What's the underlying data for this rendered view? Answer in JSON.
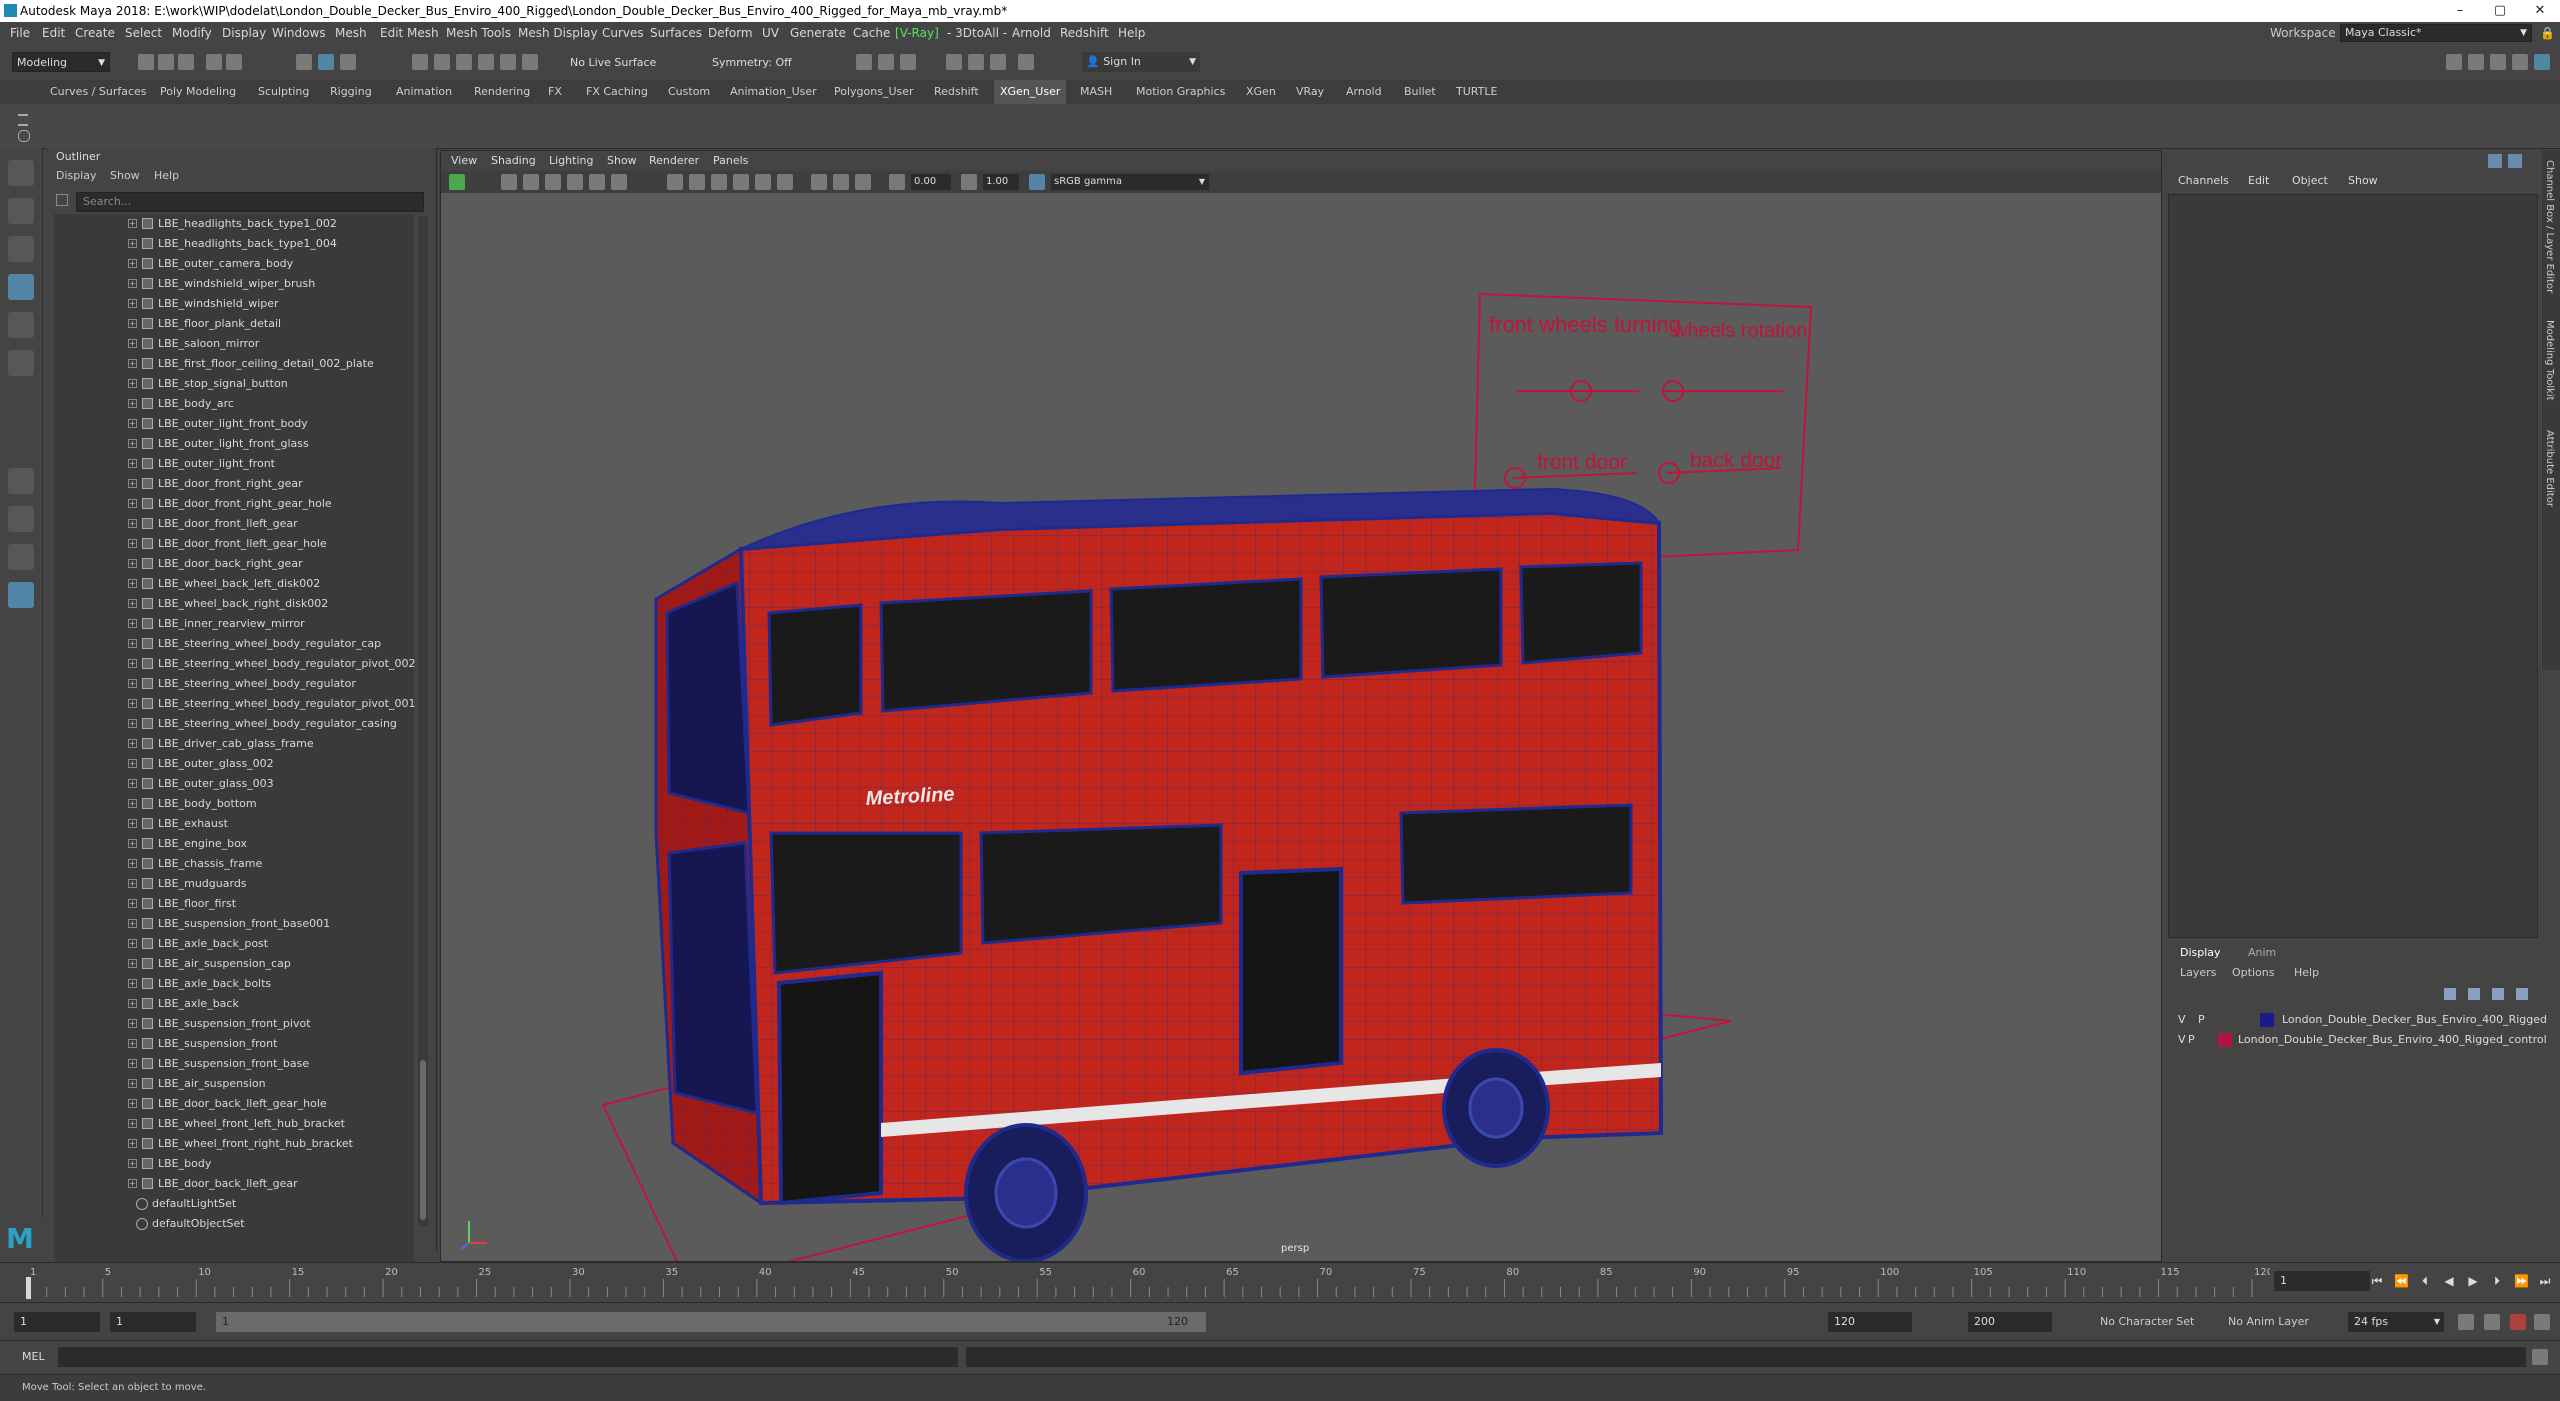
{
  "window": {
    "title": "Autodesk Maya 2018: E:\\work\\WIP\\dodelat\\London_Double_Decker_Bus_Enviro_400_Rigged\\London_Double_Decker_Bus_Enviro_400_Rigged_for_Maya_mb_vray.mb*",
    "minimize": "–",
    "maximize": "▢",
    "close": "✕"
  },
  "menubar": {
    "items": [
      "File",
      "Edit",
      "Create",
      "Select",
      "Modify",
      "Display",
      "Windows",
      "Mesh",
      "Edit Mesh",
      "Mesh Tools",
      "Mesh Display",
      "Curves",
      "Surfaces",
      "Deform",
      "UV",
      "Generate",
      "Cache",
      "V-Ray",
      "- 3DtoAll -",
      "Arnold",
      "Redshift",
      "Help"
    ],
    "workspace_label": "Workspace :",
    "workspace_value": "Maya Classic*"
  },
  "statusline": {
    "mode": "Modeling",
    "live_surface": "No Live Surface",
    "symmetry": "Symmetry: Off",
    "sign_in": "Sign In"
  },
  "shelf": {
    "tabs": [
      "Curves / Surfaces",
      "Poly Modeling",
      "Sculpting",
      "Rigging",
      "Animation",
      "Rendering",
      "FX",
      "FX Caching",
      "Custom",
      "Animation_User",
      "Polygons_User",
      "Redshift",
      "XGen_User",
      "MASH",
      "Motion Graphics",
      "XGen",
      "VRay",
      "Arnold",
      "Bullet",
      "TURTLE"
    ],
    "active": "XGen_User"
  },
  "outliner": {
    "title": "Outliner",
    "menu": [
      "Display",
      "Show",
      "Help"
    ],
    "search_placeholder": "Search...",
    "items": [
      "LBE_headlights_back_type1_002",
      "LBE_headlights_back_type1_004",
      "LBE_outer_camera_body",
      "LBE_windshield_wiper_brush",
      "LBE_windshield_wiper",
      "LBE_floor_plank_detail",
      "LBE_saloon_mirror",
      "LBE_first_floor_ceiling_detail_002_plate",
      "LBE_stop_signal_button",
      "LBE_body_arc",
      "LBE_outer_light_front_body",
      "LBE_outer_light_front_glass",
      "LBE_outer_light_front",
      "LBE_door_front_right_gear",
      "LBE_door_front_right_gear_hole",
      "LBE_door_front_lleft_gear",
      "LBE_door_front_lleft_gear_hole",
      "LBE_door_back_right_gear",
      "LBE_wheel_back_left_disk002",
      "LBE_wheel_back_right_disk002",
      "LBE_inner_rearview_mirror",
      "LBE_steering_wheel_body_regulator_cap",
      "LBE_steering_wheel_body_regulator_pivot_002",
      "LBE_steering_wheel_body_regulator",
      "LBE_steering_wheel_body_regulator_pivot_001",
      "LBE_steering_wheel_body_regulator_casing",
      "LBE_driver_cab_glass_frame",
      "LBE_outer_glass_002",
      "LBE_outer_glass_003",
      "LBE_body_bottom",
      "LBE_exhaust",
      "LBE_engine_box",
      "LBE_chassis_frame",
      "LBE_mudguards",
      "LBE_floor_first",
      "LBE_suspension_front_base001",
      "LBE_axle_back_post",
      "LBE_air_suspension_cap",
      "LBE_axle_back_bolts",
      "LBE_axle_back",
      "LBE_suspension_front_pivot",
      "LBE_suspension_front",
      "LBE_suspension_front_base",
      "LBE_air_suspension",
      "LBE_door_back_lleft_gear_hole",
      "LBE_wheel_front_left_hub_bracket",
      "LBE_wheel_front_right_hub_bracket",
      "LBE_body",
      "LBE_door_back_lleft_gear"
    ],
    "sets": [
      "defaultLightSet",
      "defaultObjectSet"
    ]
  },
  "viewport": {
    "menu": [
      "View",
      "Shading",
      "Lighting",
      "Show",
      "Renderer",
      "Panels"
    ],
    "field_a": "0.00",
    "field_b": "1.00",
    "colorspace": "sRGB gamma",
    "camera": "persp",
    "rig_labels": {
      "front_wheels": "front wheels turning",
      "wheels_rotation": "wheels rotation",
      "front_door": "front door",
      "back_door": "back door"
    },
    "bus_logo": "Metroline"
  },
  "channelbox": {
    "menu": [
      "Channels",
      "Edit",
      "Object",
      "Show"
    ],
    "side_tabs": [
      "Channel Box / Layer Editor",
      "Modeling Toolkit",
      "Attribute Editor"
    ]
  },
  "layers": {
    "tabs": [
      "Display",
      "Anim"
    ],
    "menu": [
      "Layers",
      "Options",
      "Help"
    ],
    "rows": [
      {
        "v": "V",
        "p": "P",
        "name": "London_Double_Decker_Bus_Enviro_400_Rigged",
        "color": "#1a1a8c"
      },
      {
        "v": "V",
        "p": "P",
        "name": "London_Double_Decker_Bus_Enviro_400_Rigged_control",
        "color": "#b0153e"
      }
    ]
  },
  "timeslider": {
    "ticks": [
      "1",
      "5",
      "10",
      "15",
      "20",
      "25",
      "30",
      "35",
      "40",
      "45",
      "50",
      "55",
      "60",
      "65",
      "70",
      "75",
      "80",
      "85",
      "90",
      "95",
      "100",
      "105",
      "110",
      "115",
      "120"
    ],
    "current_frame": "1"
  },
  "range": {
    "start": "1",
    "inner_start": "1",
    "slider_start": "1",
    "slider_end": "120",
    "end": "120",
    "outer_end": "200",
    "character_set": "No Character Set",
    "anim_layer": "No Anim Layer",
    "fps": "24 fps"
  },
  "cmd": {
    "label": "MEL",
    "help": "Move Tool: Select an object to move."
  },
  "colors": {
    "wire_blue": "#1f2a8f",
    "bus_red": "#c1261d",
    "control_red": "#c0143c",
    "viewport_bg": "#5b5b5b"
  }
}
